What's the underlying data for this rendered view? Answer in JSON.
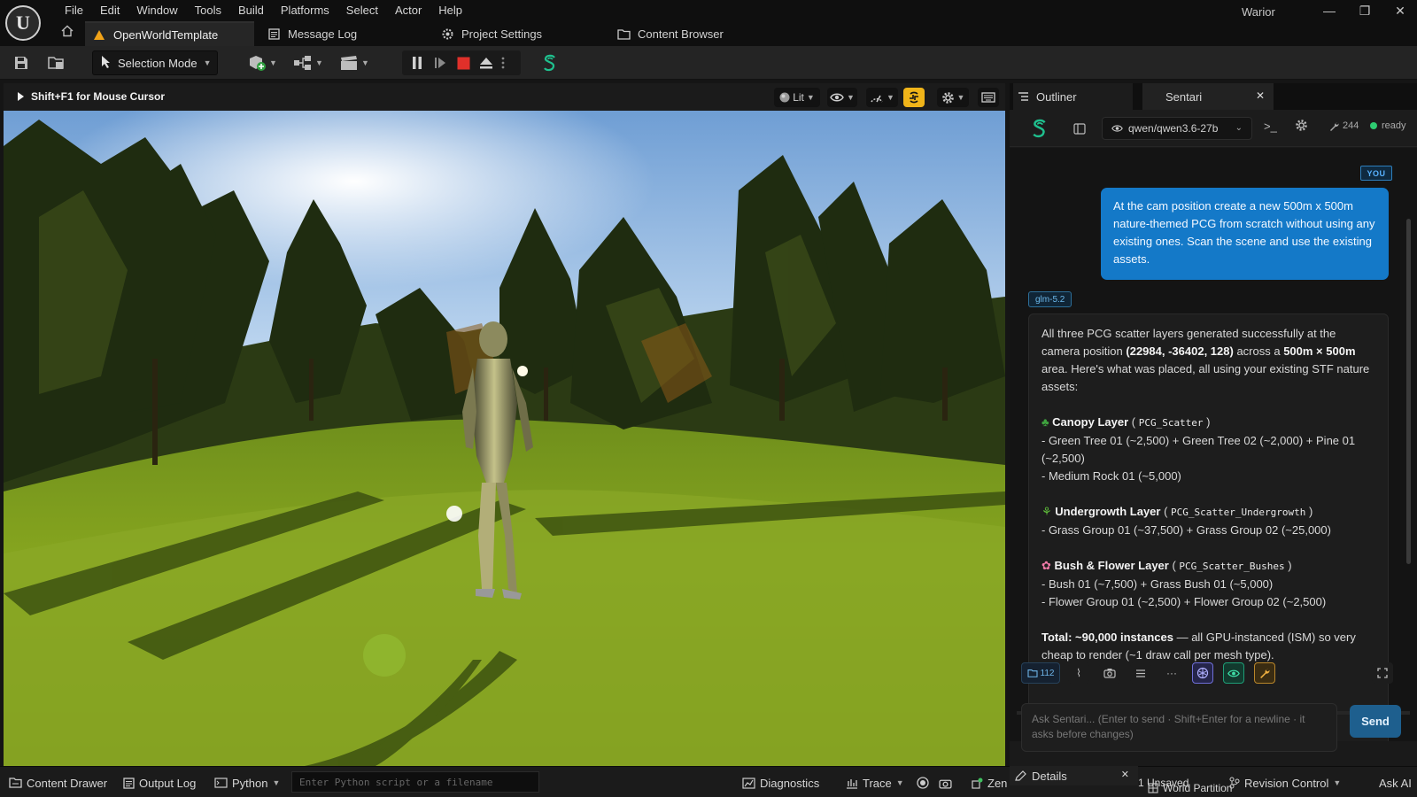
{
  "menu": [
    "File",
    "Edit",
    "Window",
    "Tools",
    "Build",
    "Platforms",
    "Select",
    "Actor",
    "Help"
  ],
  "user": "Warior",
  "window_buttons": {
    "minimize": "—",
    "restore": "❐",
    "close": "✕"
  },
  "tabs": {
    "project": "OpenWorldTemplate",
    "message_log": "Message Log",
    "project_settings": "Project Settings",
    "content_browser": "Content Browser"
  },
  "toolbar": {
    "selection_mode": "Selection Mode"
  },
  "viewport": {
    "hint": "Shift+F1 for Mouse Cursor",
    "lit_label": "Lit"
  },
  "right_panel": {
    "outliner_tab": "Outliner",
    "sentari_tab": "Sentari",
    "model": "qwen/qwen3.6-27b",
    "tool_count": "244",
    "status": "ready",
    "status_color": "#2ecc71"
  },
  "chat": {
    "you_badge": "YOU",
    "user_message": "At the cam position create a new 500m x 500m nature-themed PCG from scratch without using any existing ones. Scan the scene and use the existing assets.",
    "model_badge": "glm-5.2",
    "intro_1": "All three PCG scatter layers generated successfully at the camera position ",
    "intro_coords": "(22984, -36402, 128)",
    "intro_2": " across a ",
    "intro_area": "500m × 500m",
    "intro_3": " area. Here's what was placed, all using your existing STF nature assets:",
    "canopy_title": "Canopy Layer",
    "canopy_code": "PCG_Scatter",
    "canopy_line1": "- Green Tree 01 (~2,500) + Green Tree 02 (~2,000) + Pine 01 (~2,500)",
    "canopy_line2": "- Medium Rock 01 (~5,000)",
    "under_title": "Undergrowth Layer",
    "under_code": "PCG_Scatter_Undergrowth",
    "under_line1": "- Grass Group 01 (~37,500) + Grass Group 02 (~25,000)",
    "bush_title": "Bush & Flower Layer",
    "bush_code": "PCG_Scatter_Bushes",
    "bush_line1": "- Bush 01 (~7,500) + Grass Bush 01 (~5,000)",
    "bush_line2": "- Flower Group 01 (~2,500) + Flower Group 02 (~2,500)",
    "total_label": "Total: ~90,000 instances",
    "total_rest": " — all GPU-instanced (ISM) so very cheap to render (~1 draw call per mesh type)."
  },
  "composer": {
    "folder_count": "112",
    "placeholder": "Ask Sentari...   (Enter to send · Shift+Enter for a newline · it asks before changes)",
    "send": "Send"
  },
  "bottom": {
    "content_drawer": "Content Drawer",
    "output_log": "Output Log",
    "python": "Python",
    "python_placeholder": "Enter Python script or a filename",
    "diagnostics": "Diagnostics",
    "trace": "Trace",
    "zen": "Zen",
    "details": "Details",
    "world_partition": "World Partition",
    "unsaved": "1 Unsaved",
    "revision_control": "Revision Control",
    "ask_ai": "Ask AI"
  }
}
